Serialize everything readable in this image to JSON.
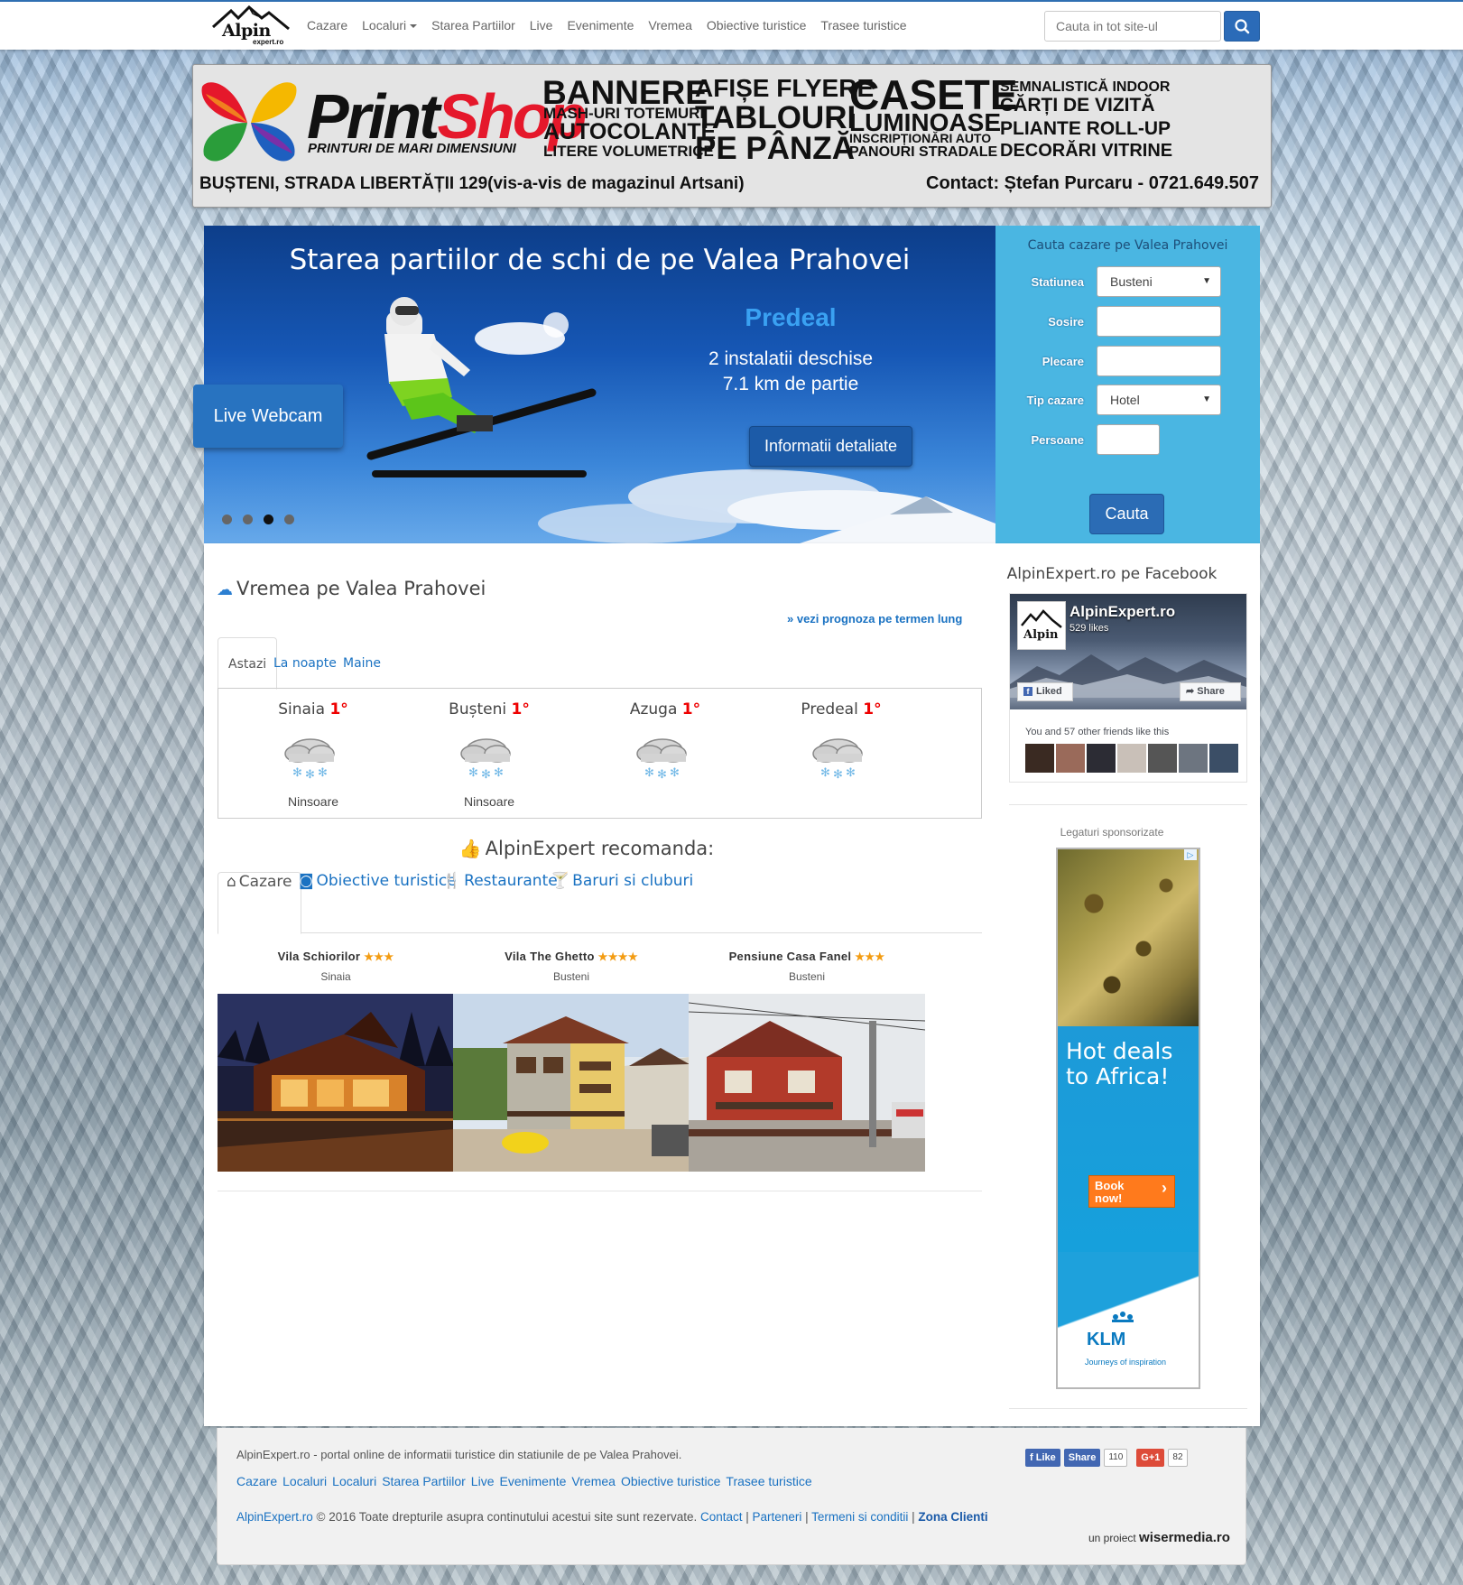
{
  "navbar": {
    "logo_text": "Alpin",
    "logo_sub": "expert.ro",
    "items": [
      {
        "label": "Cazare"
      },
      {
        "label": "Localuri",
        "dropdown": true
      },
      {
        "label": "Starea Partiilor"
      },
      {
        "label": "Live"
      },
      {
        "label": "Evenimente"
      },
      {
        "label": "Vremea"
      },
      {
        "label": "Obiective turistice"
      },
      {
        "label": "Trasee turistice"
      }
    ],
    "search_placeholder": "Cauta in tot site-ul"
  },
  "banner": {
    "logo_print": "Print",
    "logo_shop": "Shop",
    "logo_sub": "PRINTURI DE MARI DIMENSIUNI",
    "services": [
      "BANNERE",
      "MASH-URI TOTEMURI",
      "AUTOCOLANTE",
      "LITERE VOLUMETRICE",
      "AFIȘE FLYERE",
      "TABLOURI",
      "PE PÂNZĂ",
      "CASETE",
      "LUMINOASE",
      "INSCRIPȚIONĂRI AUTO",
      "PANOURI STRADALE",
      "SEMNALISTICĂ INDOOR",
      "CĂRȚI DE VIZITĂ",
      "PLIANTE ROLL-UP",
      "DECORĂRI VITRINE"
    ],
    "address": "BUȘTENI, STRADA LIBERTĂȚII 129(vis-a-vis de magazinul Artsani)",
    "contact": "Contact: Ștefan Purcaru - 0721.649.507"
  },
  "slider": {
    "title": "Starea partiilor de schi de pe Valea Prahovei",
    "station": "Predeal",
    "line1": "2 instalatii deschise",
    "line2": "7.1 km de partie",
    "button": "Informatii detaliate",
    "webcam": "Live Webcam",
    "active_dot": 3,
    "dot_count": 4
  },
  "booking": {
    "title": "Cauta cazare pe Valea Prahovei",
    "statiunea_label": "Statiunea",
    "statiunea_value": "Busteni",
    "sosire_label": "Sosire",
    "plecare_label": "Plecare",
    "tip_label": "Tip cazare",
    "tip_value": "Hotel",
    "persoane_label": "Persoane",
    "button": "Cauta"
  },
  "weather": {
    "heading": "Vremea pe Valea Prahovei",
    "long_link": "» vezi prognoza pe termen lung",
    "tabs": [
      "Astazi",
      "La noapte",
      "Maine"
    ],
    "active_tab": 0,
    "cities": [
      {
        "name": "Sinaia",
        "temp": "1°",
        "condition": "Ninsoare"
      },
      {
        "name": "Bușteni",
        "temp": "1°",
        "condition": "Ninsoare"
      },
      {
        "name": "Azuga",
        "temp": "1°",
        "condition": ""
      },
      {
        "name": "Predeal",
        "temp": "1°",
        "condition": ""
      }
    ]
  },
  "recommend": {
    "heading": "AlpinExpert recomanda:",
    "tabs": [
      {
        "label": "Cazare",
        "icon": "home-icon"
      },
      {
        "label": "Obiective turistice",
        "icon": "camera-icon"
      },
      {
        "label": "Restaurante",
        "icon": "cutlery-icon"
      },
      {
        "label": "Baruri si cluburi",
        "icon": "glass-icon"
      }
    ],
    "cards": [
      {
        "name": "Vila Schiorilor",
        "stars": "★★★",
        "location": "Sinaia"
      },
      {
        "name": "Vila The Ghetto",
        "stars": "★★★★",
        "location": "Busteni"
      },
      {
        "name": "Pensiune Casa Fanel",
        "stars": "★★★",
        "location": "Busteni"
      }
    ]
  },
  "sidebar": {
    "fb_title": "AlpinExpert.ro pe Facebook",
    "fb_page": "AlpinExpert.ro",
    "fb_likes": "529 likes",
    "fb_liked": "Liked",
    "fb_share": "Share",
    "fb_friends": "You and 57 other friends like this",
    "ad_label": "Legaturi sponsorizate",
    "ad_headline": "Hot deals to Africa!",
    "ad_button": "Book now!",
    "ad_brand": "KLM",
    "ad_tagline": "Journeys of inspiration"
  },
  "footer": {
    "description": "AlpinExpert.ro - portal online de informatii turistice din statiunile de pe Valea Prahovei.",
    "links": [
      "Cazare",
      "Localuri",
      "Localuri",
      "Starea Partiilor",
      "Live",
      "Evenimente",
      "Vremea",
      "Obiective turistice",
      "Trasee turistice"
    ],
    "copy_site": "AlpinExpert.ro",
    "copy_text": " © 2016 Toate drepturile asupra continutului acestui site sunt rezervate. ",
    "copy_contact": "Contact",
    "copy_partners": "Parteneri",
    "copy_terms": "Termeni si conditii",
    "copy_clients": "Zona Clienti",
    "fb_like": "Like",
    "fb_share": "Share",
    "fb_count": "110",
    "gplus": "G+1",
    "gplus_count": "82",
    "project_prefix": "un proiect ",
    "project_name": "wisermedia.ro"
  },
  "colors": {
    "accent": "#2b6bb8",
    "link": "#1a72c2",
    "booking_bg": "#4ab6e2",
    "temp": "#ee0000",
    "stars": "#f39c12"
  }
}
